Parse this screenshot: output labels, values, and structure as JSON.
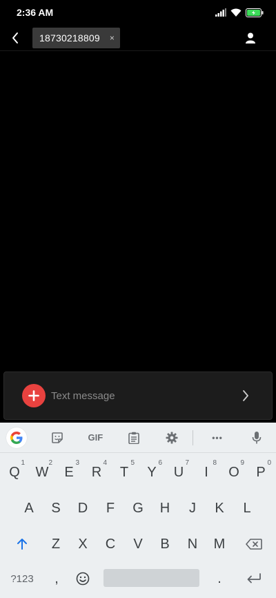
{
  "status_bar": {
    "time": "2:36 AM"
  },
  "header": {
    "recipient": "18730218809",
    "chip_close": "×"
  },
  "compose": {
    "placeholder": "Text message"
  },
  "keyboard": {
    "toolbar": {
      "gif_label": "GIF",
      "more_label": "•••"
    },
    "row1": [
      {
        "key": "Q",
        "hint": "1"
      },
      {
        "key": "W",
        "hint": "2"
      },
      {
        "key": "E",
        "hint": "3"
      },
      {
        "key": "R",
        "hint": "4"
      },
      {
        "key": "T",
        "hint": "5"
      },
      {
        "key": "Y",
        "hint": "6"
      },
      {
        "key": "U",
        "hint": "7"
      },
      {
        "key": "I",
        "hint": "8"
      },
      {
        "key": "O",
        "hint": "9"
      },
      {
        "key": "P",
        "hint": "0"
      }
    ],
    "row2": [
      "A",
      "S",
      "D",
      "F",
      "G",
      "H",
      "J",
      "K",
      "L"
    ],
    "row3": [
      "Z",
      "X",
      "C",
      "V",
      "B",
      "N",
      "M"
    ],
    "symbols_label": "?123",
    "comma": ",",
    "period": "."
  },
  "colors": {
    "accent_red": "#e8423f",
    "battery_green": "#3ddc5a",
    "shift_blue": "#1a73e8"
  }
}
